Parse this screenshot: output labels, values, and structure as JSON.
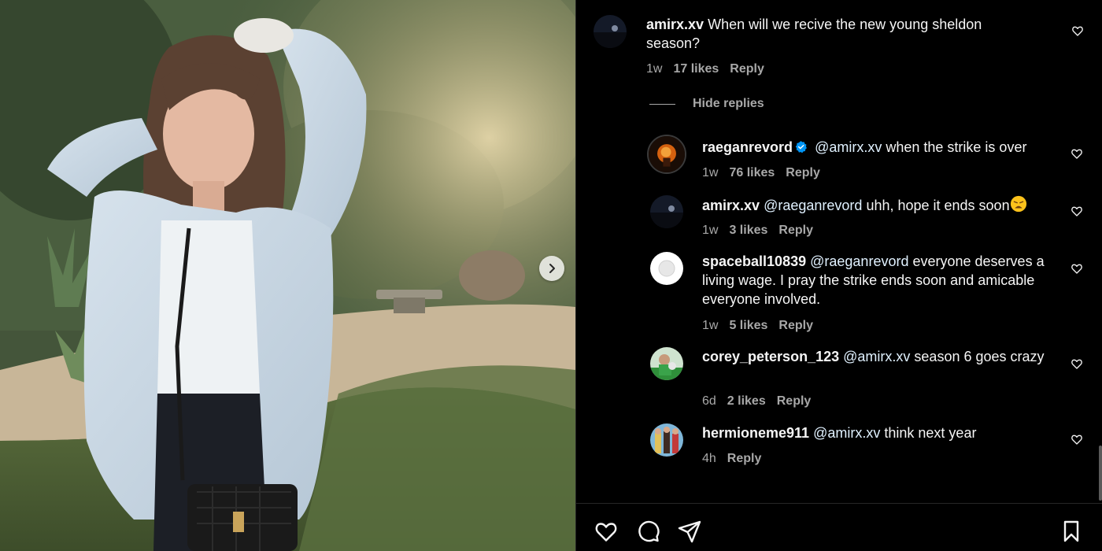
{
  "post": {
    "image_description_icon": "photo",
    "next_icon": "chevron-right-icon"
  },
  "comments": [
    {
      "username": "amirx.xv",
      "mention": "",
      "text": "When will we recive the new young sheldon season?",
      "time": "1w",
      "likes": "17 likes",
      "reply": "Reply",
      "verified": false
    },
    {
      "username": "raeganrevord",
      "mention": "@amirx.xv",
      "text": "when the strike is over",
      "time": "1w",
      "likes": "76 likes",
      "reply": "Reply",
      "verified": true
    },
    {
      "username": "amirx.xv",
      "mention": "@raeganrevord",
      "text": "uhh, hope it ends soon",
      "time": "1w",
      "likes": "3 likes",
      "reply": "Reply",
      "verified": false,
      "emoji": "weary-face"
    },
    {
      "username": "spaceball10839",
      "mention": "@raeganrevord",
      "text": "everyone deserves a living wage. I pray the strike ends soon and amicable everyone involved.",
      "time": "1w",
      "likes": "5 likes",
      "reply": "Reply",
      "verified": false
    },
    {
      "username": "corey_peterson_123",
      "mention": "@amirx.xv",
      "text": "season 6 goes crazy",
      "time": "6d",
      "likes": "2 likes",
      "reply": "Reply",
      "verified": false
    },
    {
      "username": "hermioneme911",
      "mention": "@amirx.xv",
      "text": "think next year",
      "time": "4h",
      "likes": "",
      "reply": "Reply",
      "verified": false
    }
  ],
  "replies_toggle": {
    "label": "Hide replies"
  },
  "actions": {
    "like": "heart-icon",
    "comment": "comment-icon",
    "share": "share-icon",
    "save": "bookmark-icon"
  },
  "colors": {
    "background": "#000000",
    "text": "#f5f5f5",
    "secondary": "#a8a8a8",
    "verified": "#0095f6"
  }
}
